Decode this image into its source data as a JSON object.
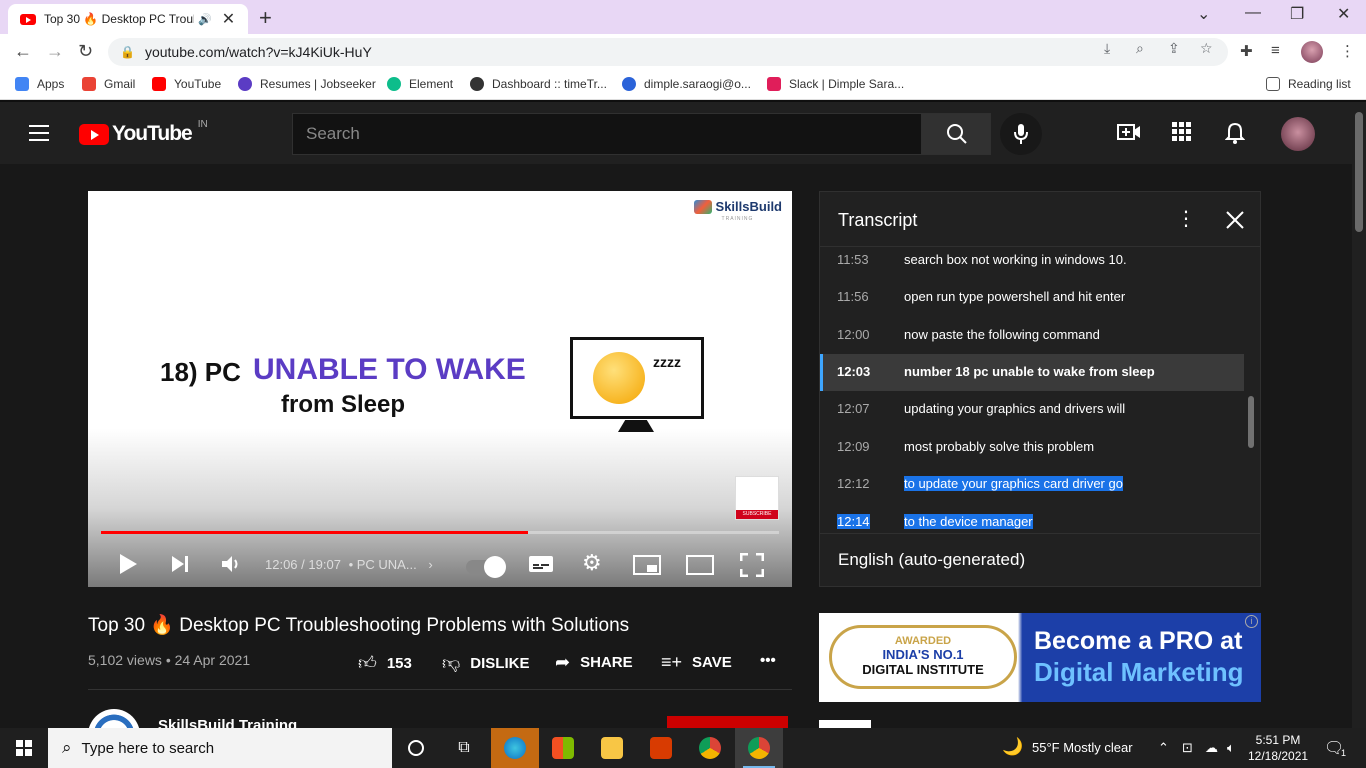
{
  "browser": {
    "tab_title": "Top 30 🔥 Desktop PC Troub",
    "address": "youtube.com/watch?v=kJ4KiUk-HuY",
    "bookmarks": [
      {
        "label": "Apps",
        "color": "#4285f4"
      },
      {
        "label": "Gmail",
        "color": "#ea4335"
      },
      {
        "label": "YouTube",
        "color": "#ff0000"
      },
      {
        "label": "Resumes | Jobseeker",
        "color": "#5b3cc4"
      },
      {
        "label": "Element",
        "color": "#0dbd8b"
      },
      {
        "label": "Dashboard :: timeTr...",
        "color": "#333333"
      },
      {
        "label": "dimple.saraogi@o...",
        "color": "#2b63d9"
      },
      {
        "label": "Slack | Dimple Sara...",
        "color": "#e01e5a"
      }
    ],
    "reading_list": "Reading list"
  },
  "youtube": {
    "logo_text": "YouTube",
    "country_code": "IN",
    "search_placeholder": "Search"
  },
  "player": {
    "brand": "SkillsBuild",
    "brand_sub": "TRAINING",
    "slide_number": "18)  PC",
    "slide_headline": "UNABLE TO WAKE",
    "slide_subline": "from Sleep",
    "zzz": "zzzz",
    "subscribe_badge": "SUBSCRIBE",
    "current_time": "12:06",
    "duration": "19:07",
    "chapter": "• PC UNA...",
    "progress_fraction": 0.63
  },
  "transcript": {
    "title": "Transcript",
    "language": "English (auto-generated)",
    "rows": [
      {
        "time": "11:53",
        "text": "search box not working in windows 10."
      },
      {
        "time": "11:56",
        "text": "open run type powershell and hit enter"
      },
      {
        "time": "12:00",
        "text": "now paste the following command"
      },
      {
        "time": "12:03",
        "text": "number 18 pc unable to wake from sleep"
      },
      {
        "time": "12:07",
        "text": "updating your graphics and drivers will"
      },
      {
        "time": "12:09",
        "text": "most probably solve this problem"
      },
      {
        "time": "12:12",
        "text": "to update your graphics card driver go"
      },
      {
        "time": "12:14",
        "text": "to the device manager"
      }
    ]
  },
  "video": {
    "title": "Top 30 🔥 Desktop PC Troubleshooting Problems with Solutions",
    "meta": "5,102 views • 24 Apr 2021",
    "likes": "153",
    "dislike_label": "DISLIKE",
    "share_label": "SHARE",
    "save_label": "SAVE",
    "channel": "SkillsBuild Training"
  },
  "ad": {
    "badge_l1": "AWARDED",
    "badge_l2": "INDIA'S NO.1",
    "badge_l3": "DIGITAL INSTITUTE",
    "line1": "Become a PRO at",
    "line2": "Digital Marketing"
  },
  "taskbar": {
    "search_placeholder": "Type here to search",
    "weather": "55°F  Mostly clear",
    "time": "5:51 PM",
    "date": "12/18/2021",
    "notifications": "1"
  }
}
